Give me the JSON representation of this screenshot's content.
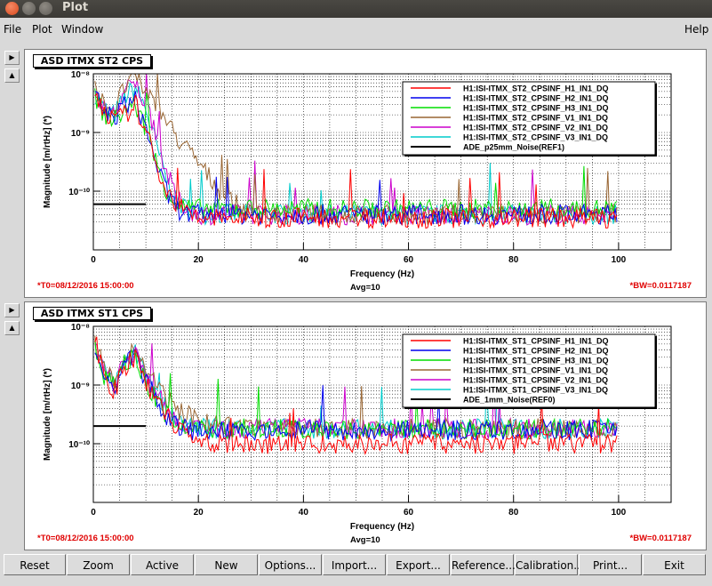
{
  "window": {
    "title": "Plot"
  },
  "menu": {
    "file": "File",
    "plot": "Plot",
    "window": "Window",
    "help": "Help"
  },
  "colors": {
    "red": "#ff0000",
    "blue": "#0000ee",
    "green": "#00dd00",
    "brown": "#996633",
    "magenta": "#cc00cc",
    "cyan": "#00cccc",
    "black": "#000000",
    "status_red": "#e00000"
  },
  "plots": [
    {
      "title": "ASD ITMX ST2 CPS",
      "ylabel": "Magnitude [m/rtHz] (*)",
      "xlabel": "Frequency (Hz)",
      "yticks": [
        "10⁻⁸",
        "10⁻⁹",
        "10⁻¹⁰"
      ],
      "xticks": [
        "0",
        "20",
        "40",
        "60",
        "80",
        "100"
      ],
      "legend": [
        "H1:ISI-ITMX_ST2_CPSINF_H1_IN1_DQ",
        "H1:ISI-ITMX_ST2_CPSINF_H2_IN1_DQ",
        "H1:ISI-ITMX_ST2_CPSINF_H3_IN1_DQ",
        "H1:ISI-ITMX_ST2_CPSINF_V1_IN1_DQ",
        "H1:ISI-ITMX_ST2_CPSINF_V2_IN1_DQ",
        "H1:ISI-ITMX_ST2_CPSINF_V3_IN1_DQ",
        "ADE_p25mm_Noise(REF1)"
      ],
      "t0": "*T0=08/12/2016 15:00:00",
      "avg": "Avg=10",
      "bw": "*BW=0.0117187"
    },
    {
      "title": "ASD ITMX ST1 CPS",
      "ylabel": "Magnitude [m/rtHz] (*)",
      "xlabel": "Frequency (Hz)",
      "yticks": [
        "10⁻⁸",
        "10⁻⁹",
        "10⁻¹⁰"
      ],
      "xticks": [
        "0",
        "20",
        "40",
        "60",
        "80",
        "100"
      ],
      "legend": [
        "H1:ISI-ITMX_ST1_CPSINF_H1_IN1_DQ",
        "H1:ISI-ITMX_ST1_CPSINF_H2_IN1_DQ",
        "H1:ISI-ITMX_ST1_CPSINF_H3_IN1_DQ",
        "H1:ISI-ITMX_ST1_CPSINF_V1_IN1_DQ",
        "H1:ISI-ITMX_ST1_CPSINF_V2_IN1_DQ",
        "H1:ISI-ITMX_ST1_CPSINF_V3_IN1_DQ",
        "ADE_1mm_Noise(REF0)"
      ],
      "t0": "*T0=08/12/2016 15:00:00",
      "avg": "Avg=10",
      "bw": "*BW=0.0117187"
    }
  ],
  "chart_data": [
    {
      "type": "line",
      "title": "ASD ITMX ST2 CPS",
      "xlabel": "Frequency (Hz)",
      "ylabel": "Magnitude [m/rtHz] (*)",
      "xlim": [
        0,
        110
      ],
      "ylim": [
        1e-11,
        1e-08
      ],
      "yscale": "log",
      "grid": true,
      "legend_position": "top-right",
      "x": [
        0,
        2,
        4,
        6,
        8,
        10,
        12,
        14,
        16,
        18,
        20,
        25,
        30,
        40,
        60,
        80,
        100
      ],
      "series": [
        {
          "name": "H1:ISI-ITMX_ST2_CPSINF_H1_IN1_DQ",
          "color": "red",
          "values": [
            6e-09,
            2.5e-09,
            1.5e-09,
            2e-09,
            3e-09,
            1e-09,
            3e-10,
            1e-10,
            6e-11,
            4e-11,
            3.5e-11,
            3.5e-11,
            3.5e-11,
            3.5e-11,
            3.5e-11,
            3.5e-11,
            3.5e-11
          ]
        },
        {
          "name": "H1:ISI-ITMX_ST2_CPSINF_H2_IN1_DQ",
          "color": "blue",
          "values": [
            5e-09,
            2.2e-09,
            1.8e-09,
            3e-09,
            3.5e-09,
            1.2e-09,
            3e-10,
            9e-11,
            5e-11,
            4e-11,
            4e-11,
            4e-11,
            4e-11,
            4e-11,
            4e-11,
            4e-11,
            4e-11
          ]
        },
        {
          "name": "H1:ISI-ITMX_ST2_CPSINF_H3_IN1_DQ",
          "color": "green",
          "values": [
            5e-09,
            2e-09,
            1.6e-09,
            2.5e-09,
            3e-09,
            1.1e-09,
            3e-10,
            1e-10,
            6e-11,
            5e-11,
            5e-11,
            5e-11,
            5e-11,
            5e-11,
            5e-11,
            5e-11,
            5e-11
          ]
        },
        {
          "name": "H1:ISI-ITMX_ST2_CPSINF_V1_IN1_DQ",
          "color": "brown",
          "values": [
            6e-09,
            3e-09,
            2.5e-09,
            6e-09,
            9e-09,
            5e-09,
            3e-09,
            1.5e-09,
            8e-10,
            5e-10,
            3e-10,
            8e-11,
            4e-11,
            4e-11,
            4e-11,
            4e-11,
            4e-11
          ]
        },
        {
          "name": "H1:ISI-ITMX_ST2_CPSINF_V2_IN1_DQ",
          "color": "magenta",
          "values": [
            6e-09,
            2.5e-09,
            2e-09,
            5e-09,
            7e-09,
            3e-09,
            8e-10,
            2e-10,
            7e-11,
            5e-11,
            4e-11,
            4e-11,
            4e-11,
            4e-11,
            4e-11,
            4e-11,
            4e-11
          ]
        },
        {
          "name": "H1:ISI-ITMX_ST2_CPSINF_V3_IN1_DQ",
          "color": "cyan",
          "values": [
            5e-09,
            2.5e-09,
            2e-09,
            4e-09,
            6e-09,
            2.5e-09,
            6e-10,
            1.5e-10,
            6e-11,
            5e-11,
            4e-11,
            4e-11,
            4e-11,
            4e-11,
            4e-11,
            4e-11,
            4e-11
          ]
        },
        {
          "name": "ADE_p25mm_Noise(REF1)",
          "color": "black",
          "x": [
            0,
            10
          ],
          "values": [
            6e-11,
            6e-11
          ]
        }
      ]
    },
    {
      "type": "line",
      "title": "ASD ITMX ST1 CPS",
      "xlabel": "Frequency (Hz)",
      "ylabel": "Magnitude [m/rtHz] (*)",
      "xlim": [
        0,
        110
      ],
      "ylim": [
        1e-11,
        1e-08
      ],
      "yscale": "log",
      "grid": true,
      "legend_position": "top-right",
      "x": [
        0,
        2,
        4,
        6,
        8,
        10,
        12,
        14,
        16,
        18,
        20,
        25,
        30,
        40,
        60,
        80,
        100
      ],
      "series": [
        {
          "name": "H1:ISI-ITMX_ST1_CPSINF_H1_IN1_DQ",
          "color": "red",
          "values": [
            8e-09,
            1.5e-09,
            8e-10,
            2e-09,
            3e-09,
            1e-09,
            5e-10,
            3e-10,
            2e-10,
            1.2e-10,
            1e-10,
            1e-10,
            1e-10,
            1e-10,
            1e-10,
            1e-10,
            1e-10
          ]
        },
        {
          "name": "H1:ISI-ITMX_ST1_CPSINF_H2_IN1_DQ",
          "color": "blue",
          "values": [
            6e-09,
            1.5e-09,
            9e-10,
            2.5e-09,
            3e-09,
            1.2e-09,
            6e-10,
            3e-10,
            2e-10,
            1.7e-10,
            1.7e-10,
            1.7e-10,
            1.7e-10,
            1.7e-10,
            1.7e-10,
            1.7e-10,
            1.7e-10
          ]
        },
        {
          "name": "H1:ISI-ITMX_ST1_CPSINF_H3_IN1_DQ",
          "color": "green",
          "values": [
            6e-09,
            1.5e-09,
            9e-10,
            2.5e-09,
            3e-09,
            1.2e-09,
            6e-10,
            3e-10,
            2e-10,
            1.8e-10,
            1.8e-10,
            1.8e-10,
            1.8e-10,
            1.8e-10,
            1.8e-10,
            1.8e-10,
            1.8e-10
          ]
        },
        {
          "name": "H1:ISI-ITMX_ST1_CPSINF_V1_IN1_DQ",
          "color": "brown",
          "values": [
            6e-09,
            2e-09,
            1.2e-09,
            3e-09,
            4e-09,
            2e-09,
            1e-09,
            6e-10,
            4e-10,
            3e-10,
            2.5e-10,
            2e-10,
            1.8e-10,
            1.8e-10,
            1.8e-10,
            1.8e-10,
            1.8e-10
          ]
        },
        {
          "name": "H1:ISI-ITMX_ST1_CPSINF_V2_IN1_DQ",
          "color": "magenta",
          "values": [
            6e-09,
            1.8e-09,
            1e-09,
            2.8e-09,
            3.5e-09,
            1.5e-09,
            7e-10,
            4e-10,
            2.5e-10,
            2e-10,
            1.8e-10,
            1.8e-10,
            1.8e-10,
            1.8e-10,
            1.8e-10,
            1.8e-10,
            1.8e-10
          ]
        },
        {
          "name": "H1:ISI-ITMX_ST1_CPSINF_V3_IN1_DQ",
          "color": "cyan",
          "values": [
            6e-09,
            1.8e-09,
            1e-09,
            2.8e-09,
            3.5e-09,
            1.5e-09,
            7e-10,
            4e-10,
            2.5e-10,
            2e-10,
            1.8e-10,
            1.8e-10,
            1.8e-10,
            1.8e-10,
            1.8e-10,
            1.8e-10,
            1.8e-10
          ]
        },
        {
          "name": "ADE_1mm_Noise(REF0)",
          "color": "black",
          "x": [
            0,
            10
          ],
          "values": [
            2e-10,
            2e-10
          ]
        }
      ]
    }
  ],
  "buttons": [
    "Reset",
    "Zoom",
    "Active",
    "New",
    "Options...",
    "Import...",
    "Export...",
    "Reference...",
    "Calibration...",
    "Print...",
    "Exit"
  ]
}
